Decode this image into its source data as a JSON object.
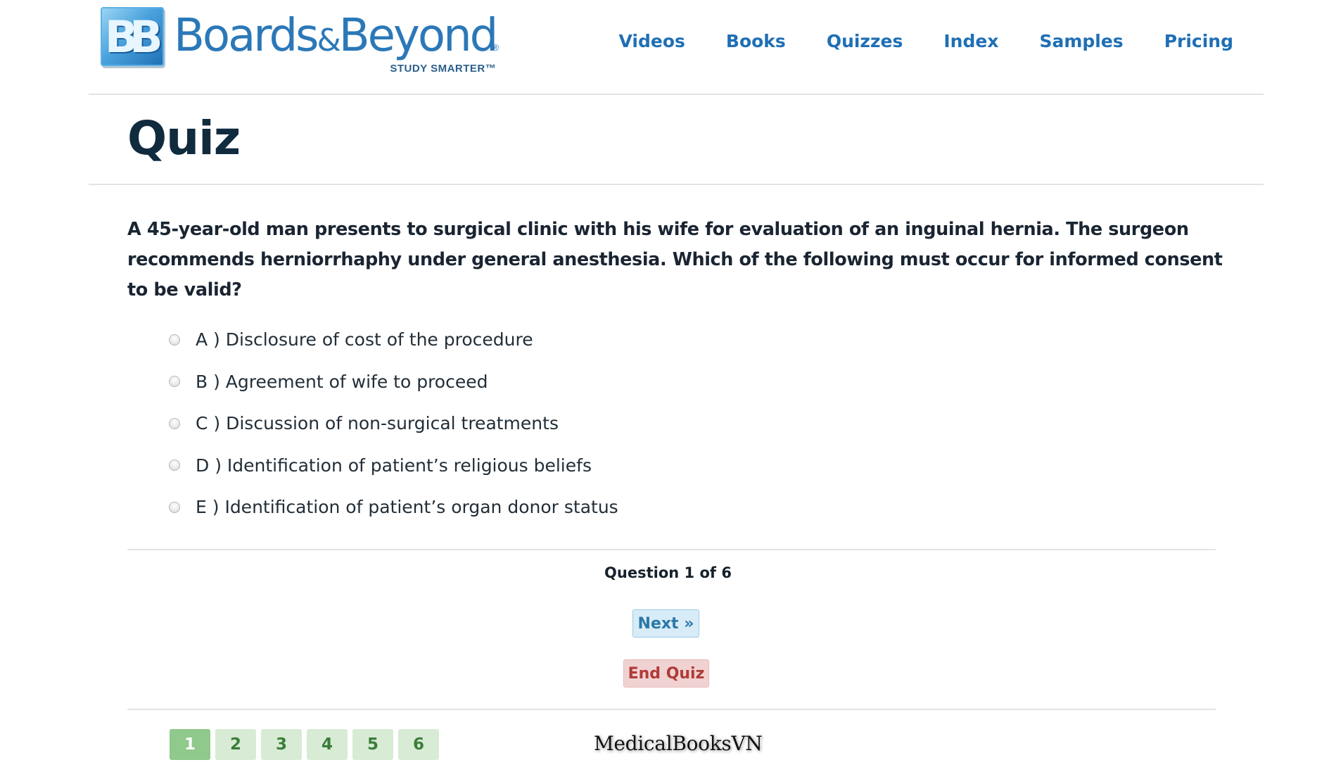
{
  "brand": {
    "badge": "BB",
    "name_part1": "Boards",
    "name_amp": "&",
    "name_part2": "Beyond",
    "registered": "®",
    "tagline": "STUDY SMARTER™"
  },
  "nav": [
    "Videos",
    "Books",
    "Quizzes",
    "Index",
    "Samples",
    "Pricing"
  ],
  "page": {
    "title": "Quiz"
  },
  "quiz": {
    "question": "A 45-year-old man presents to surgical clinic with his wife for evaluation of an inguinal hernia. The surgeon recommends herniorrhaphy under general anesthesia. Which of the following must occur for informed consent to be valid?",
    "options": [
      "A ) Disclosure of cost of the procedure",
      "B ) Agreement of wife to proceed",
      "C ) Discussion of non-surgical treatments",
      "D ) Identification of patient’s religious beliefs",
      "E ) Identification of patient’s organ donor status"
    ],
    "counter": "Question 1 of 6",
    "next_label": "Next »",
    "end_label": "End Quiz",
    "pages": [
      "1",
      "2",
      "3",
      "4",
      "5",
      "6"
    ],
    "current_page": "1"
  },
  "watermark": "MedicalBooksVN",
  "colors": {
    "brand_blue": "#2b78b8",
    "nav_blue": "#1f6fb5",
    "title_navy": "#102a3e",
    "next_bg": "#d7ecf7",
    "end_bg": "#f1d2d2",
    "end_text": "#b03a36",
    "page_active": "#8fc98c",
    "page_inactive": "#d8ebd4"
  }
}
